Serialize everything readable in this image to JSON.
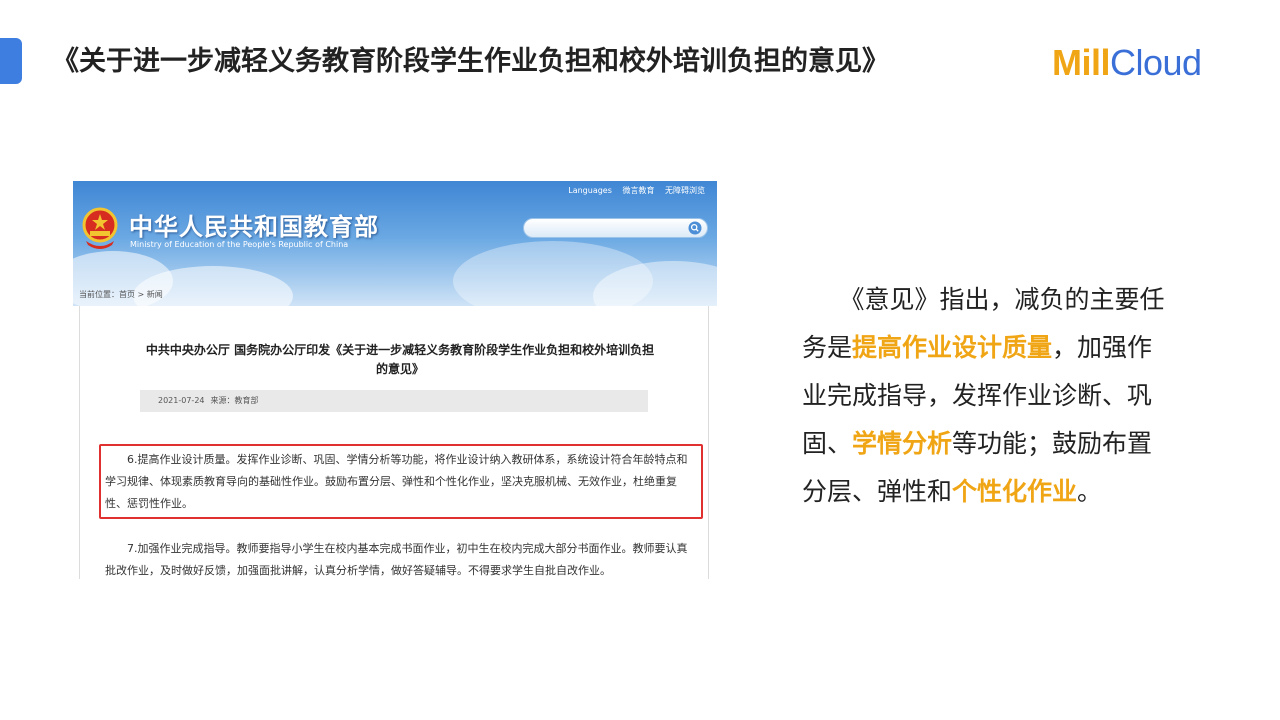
{
  "slide": {
    "title": "《关于进一步减轻义务教育阶段学生作业负担和校外培训负担的意见》",
    "logo_part1": "Mill",
    "logo_part2": "Cloud",
    "accent_color": "#3d7ee0",
    "highlight_color": "#f0a515"
  },
  "screenshot": {
    "top_links": [
      "Languages",
      "微言教育",
      "无障碍浏览"
    ],
    "ministry_name": "中华人民共和国教育部",
    "ministry_en": "Ministry of Education of the People's Republic of China",
    "breadcrumb": "当前位置：首页 > 新闻",
    "article_title": "中共中央办公厅 国务院办公厅印发《关于进一步减轻义务教育阶段学生作业负担和校外培训负担的意见》",
    "date": "2021-07-24",
    "source": "来源：教育部",
    "para6": "6.提高作业设计质量。发挥作业诊断、巩固、学情分析等功能，将作业设计纳入教研体系，系统设计符合年龄特点和学习规律、体现素质教育导向的基础性作业。鼓励布置分层、弹性和个性化作业，坚决克服机械、无效作业，杜绝重复性、惩罚性作业。",
    "para7": "7.加强作业完成指导。教师要指导小学生在校内基本完成书面作业，初中生在校内完成大部分书面作业。教师要认真批改作业，及时做好反馈，加强面批讲解，认真分析学情，做好答疑辅导。不得要求学生自批自改作业。"
  },
  "summary": {
    "line1": "《意见》指出，减负的主要任",
    "line2_pre": "务是",
    "line2_hl": "提高作业设计质量",
    "line2_post": "，加强作",
    "line3": "业完成指导，发挥作业诊断、巩",
    "line4_pre": "固、",
    "line4_hl": "学情分析",
    "line4_post": "等功能；鼓励布置",
    "line5_pre": "分层、弹性和",
    "line5_hl": "个性化作业",
    "line5_post": "。"
  }
}
